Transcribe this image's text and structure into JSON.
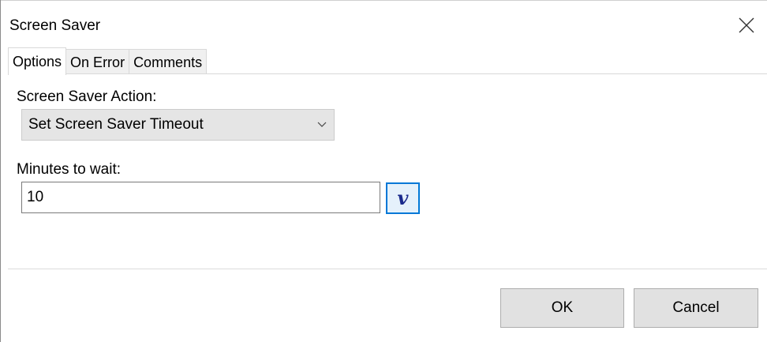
{
  "window": {
    "title": "Screen Saver",
    "close_icon": "close-icon"
  },
  "tabs": [
    {
      "label": "Options",
      "active": true
    },
    {
      "label": "On Error",
      "active": false
    },
    {
      "label": "Comments",
      "active": false
    }
  ],
  "options": {
    "action_label": "Screen Saver Action:",
    "action_value": "Set Screen Saver Timeout",
    "dropdown_icon": "chevron-down-icon",
    "minutes_label": "Minutes to wait:",
    "minutes_value": "10",
    "variable_button_glyph": "v"
  },
  "footer": {
    "ok_label": "OK",
    "cancel_label": "Cancel"
  },
  "colors": {
    "accent": "#0078d7",
    "button_bg": "#e1e1e1",
    "select_bg": "#e5e5e5"
  }
}
